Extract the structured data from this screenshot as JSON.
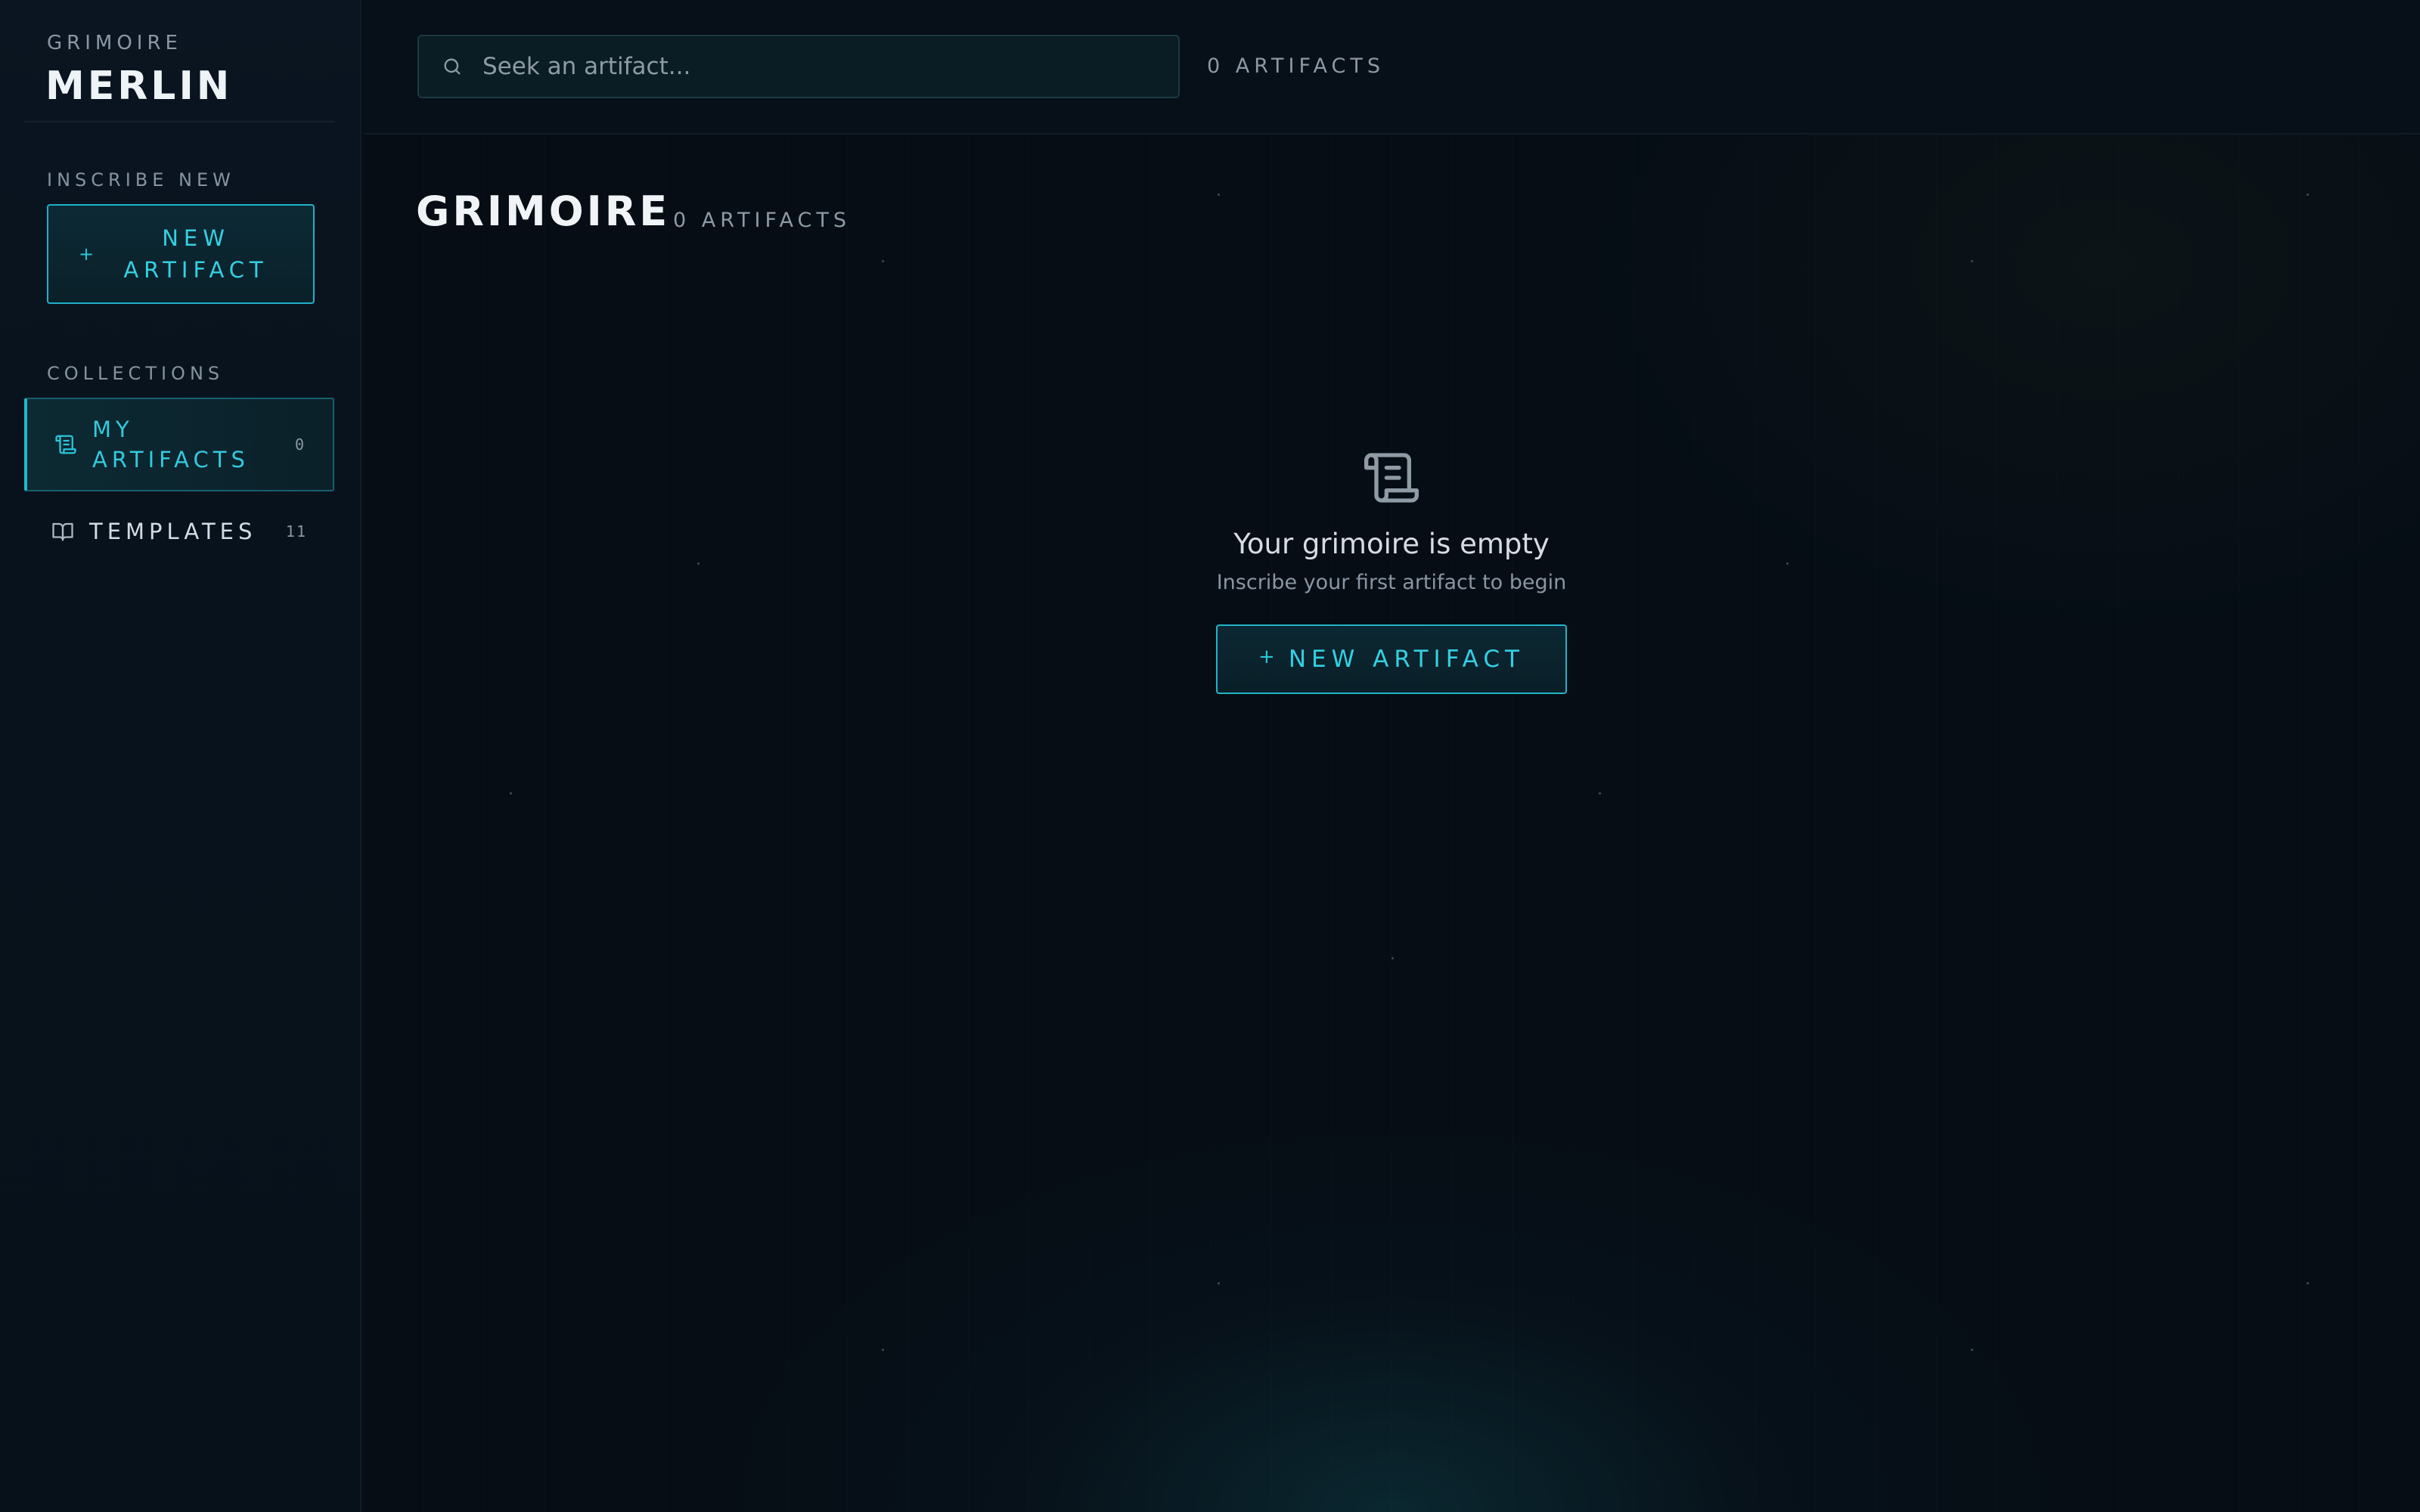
{
  "sidebar": {
    "brand_small": "GRIMOIRE",
    "brand_big": "MERLIN",
    "inscribe_label": "INSCRIBE NEW",
    "new_button_label": "NEW ARTIFACT",
    "collections_label": "COLLECTIONS",
    "items": [
      {
        "label": "MY ARTIFACTS",
        "count": "0",
        "icon": "scroll-icon",
        "active": true
      },
      {
        "label": "TEMPLATES",
        "count": "11",
        "icon": "book-open-icon",
        "active": false
      }
    ]
  },
  "topbar": {
    "search_placeholder": "Seek an artifact...",
    "count_label": "0 ARTIFACTS"
  },
  "main": {
    "title": "GRIMOIRE",
    "subtitle": "0 ARTIFACTS",
    "empty": {
      "icon": "scroll-icon",
      "title": "Your grimoire is empty",
      "subtitle": "Inscribe your first artifact to begin",
      "button_label": "NEW ARTIFACT"
    }
  },
  "colors": {
    "accent": "#22b8cc",
    "background": "#060d15",
    "sidebar": "#08121c"
  }
}
